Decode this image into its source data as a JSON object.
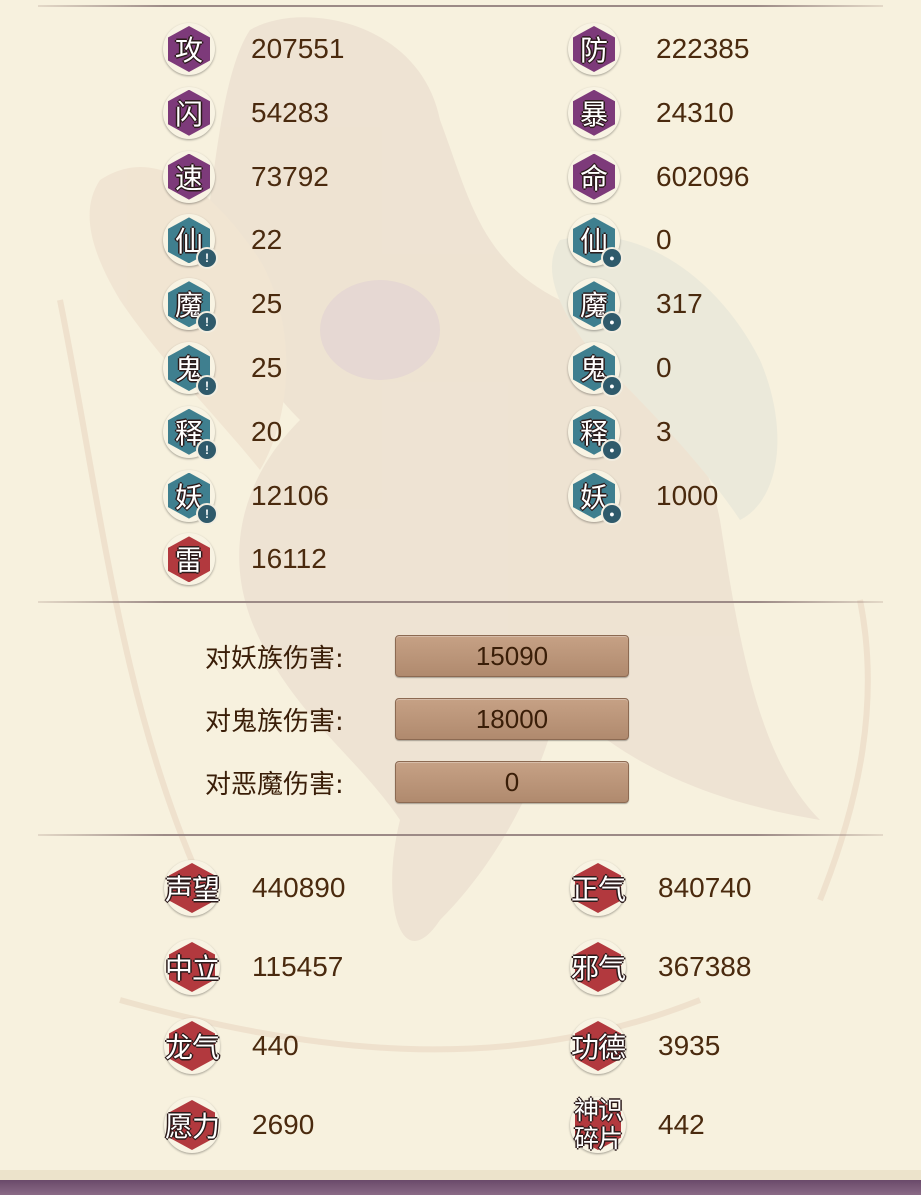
{
  "stats_left": [
    {
      "label": "攻",
      "value": "207551",
      "color": "purple",
      "badge": false
    },
    {
      "label": "闪",
      "value": "54283",
      "color": "purple",
      "badge": false
    },
    {
      "label": "速",
      "value": "73792",
      "color": "purple",
      "badge": false
    },
    {
      "label": "仙",
      "value": "22",
      "color": "teal",
      "badge": true,
      "badge_icon": "exclamation-icon"
    },
    {
      "label": "魔",
      "value": "25",
      "color": "teal",
      "badge": true,
      "badge_icon": "exclamation-icon"
    },
    {
      "label": "鬼",
      "value": "25",
      "color": "teal",
      "badge": true,
      "badge_icon": "exclamation-icon"
    },
    {
      "label": "释",
      "value": "20",
      "color": "teal",
      "badge": true,
      "badge_icon": "exclamation-icon"
    },
    {
      "label": "妖",
      "value": "12106",
      "color": "teal",
      "badge": true,
      "badge_icon": "exclamation-icon"
    },
    {
      "label": "雷",
      "value": "16112",
      "color": "red",
      "badge": false
    }
  ],
  "stats_right": [
    {
      "label": "防",
      "value": "222385",
      "color": "purple",
      "badge": false
    },
    {
      "label": "暴",
      "value": "24310",
      "color": "purple",
      "badge": false
    },
    {
      "label": "命",
      "value": "602096",
      "color": "purple",
      "badge": false
    },
    {
      "label": "仙",
      "value": "0",
      "color": "teal",
      "badge": true,
      "badge_icon": "shield-icon"
    },
    {
      "label": "魔",
      "value": "317",
      "color": "teal",
      "badge": true,
      "badge_icon": "shield-icon"
    },
    {
      "label": "鬼",
      "value": "0",
      "color": "teal",
      "badge": true,
      "badge_icon": "shield-icon"
    },
    {
      "label": "释",
      "value": "3",
      "color": "teal",
      "badge": true,
      "badge_icon": "shield-icon"
    },
    {
      "label": "妖",
      "value": "1000",
      "color": "teal",
      "badge": true,
      "badge_icon": "shield-icon"
    }
  ],
  "damage_bonuses": [
    {
      "label": "对妖族伤害:",
      "value": "15090"
    },
    {
      "label": "对鬼族伤害:",
      "value": "18000"
    },
    {
      "label": "对恶魔伤害:",
      "value": "0"
    }
  ],
  "reputation_left": [
    {
      "label": "声望",
      "value": "440890"
    },
    {
      "label": "中立",
      "value": "115457"
    },
    {
      "label": "龙气",
      "value": "440"
    },
    {
      "label": "愿力",
      "value": "2690"
    }
  ],
  "reputation_right": [
    {
      "label": "正气",
      "value": "840740"
    },
    {
      "label": "邪气",
      "value": "367388"
    },
    {
      "label": "功德",
      "value": "3935"
    },
    {
      "label": "神识\n碎片",
      "value": "442"
    }
  ],
  "colors": {
    "purple": "#7d3a7a",
    "teal": "#3f7f8f",
    "red": "#b2393e",
    "background": "#f7f1de",
    "value_box": "#b08a6e"
  }
}
